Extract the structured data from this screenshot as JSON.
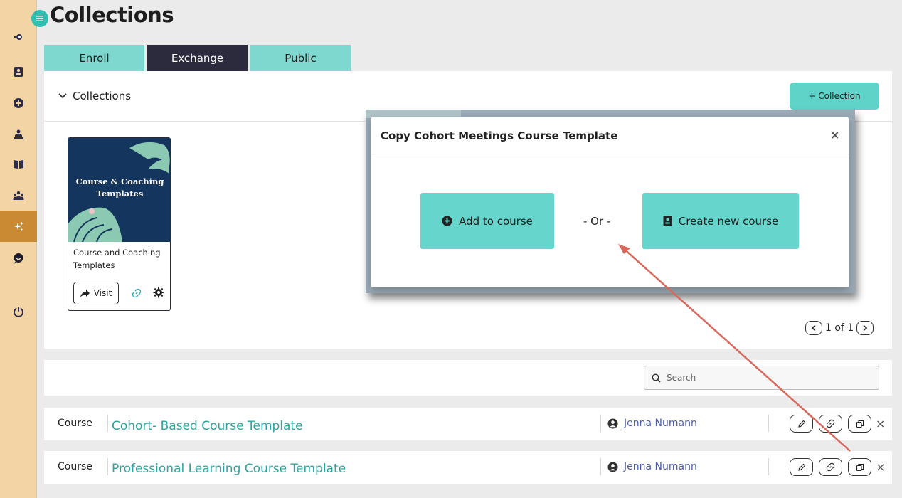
{
  "page": {
    "title": "Collections"
  },
  "sidebar": {
    "items": [
      {
        "name": "dashboard-icon"
      },
      {
        "name": "contacts-icon"
      },
      {
        "name": "add-icon"
      },
      {
        "name": "teacher-icon"
      },
      {
        "name": "book-icon"
      },
      {
        "name": "community-icon"
      },
      {
        "name": "exchange-icon",
        "active": true
      },
      {
        "name": "chat-icon"
      },
      {
        "name": "power-icon"
      }
    ],
    "active_color": "#c98a33",
    "background": "#f3d4a5"
  },
  "tabs": [
    {
      "label": "Enroll"
    },
    {
      "label": "Exchange",
      "active": true
    },
    {
      "label": "Public"
    }
  ],
  "collections_panel": {
    "toggle_label": "Collections",
    "add_button_label": "+ Collection",
    "card": {
      "cover_line1": "Course & Coaching",
      "cover_line2": "Templates",
      "caption": "Course and Coaching Templates",
      "visit_label": "Visit"
    },
    "pagination": {
      "label": "1 of 1"
    }
  },
  "search": {
    "placeholder": "Search"
  },
  "rows": [
    {
      "type": "Course",
      "title": "Cohort- Based Course Template",
      "owner": "Jenna Numann"
    },
    {
      "type": "Course",
      "title": "Professional Learning Course Template",
      "owner": "Jenna Numann"
    }
  ],
  "modal": {
    "title": "Copy Cohort Meetings Course Template",
    "close_symbol": "×",
    "add_to_course_label": "Add to course",
    "or_label": "- Or -",
    "create_new_course_label": "Create new course"
  },
  "row_close_symbol": "×",
  "colors": {
    "accent_teal": "#5fd3c8",
    "link_teal": "#2aa6a0",
    "owner_blue": "#4a5aa8",
    "annotation_arrow": "#d9685c"
  }
}
